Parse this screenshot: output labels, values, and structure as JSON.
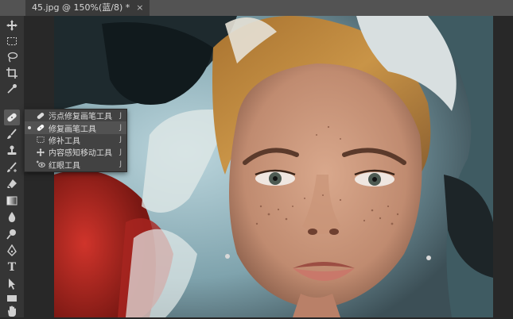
{
  "document": {
    "tab_title": "45.jpg @ 150%(蓝/8) *",
    "close_glyph": "×"
  },
  "tools": [
    {
      "name": "move-tool",
      "icon": "move-icon"
    },
    {
      "name": "marquee-tool",
      "icon": "rect-marquee-icon"
    },
    {
      "name": "lasso-tool",
      "icon": "lasso-icon"
    },
    {
      "name": "crop-tool",
      "icon": "crop-icon"
    },
    {
      "name": "eyedropper-tool",
      "icon": "eyedropper-icon"
    },
    {
      "name": "healing-brush-tool",
      "icon": "bandage-icon",
      "active": true
    },
    {
      "name": "brush-tool",
      "icon": "brush-icon"
    },
    {
      "name": "clone-stamp-tool",
      "icon": "stamp-icon"
    },
    {
      "name": "history-brush-tool",
      "icon": "history-brush-icon"
    },
    {
      "name": "eraser-tool",
      "icon": "eraser-icon"
    },
    {
      "name": "gradient-tool",
      "icon": "gradient-icon"
    },
    {
      "name": "blur-tool",
      "icon": "drop-icon"
    },
    {
      "name": "dodge-tool",
      "icon": "dodge-icon"
    },
    {
      "name": "pen-tool",
      "icon": "pen-icon"
    },
    {
      "name": "type-tool",
      "icon": "type-icon",
      "glyph": "T"
    },
    {
      "name": "path-selection-tool",
      "icon": "arrow-icon"
    },
    {
      "name": "rectangle-tool",
      "icon": "rectangle-icon"
    },
    {
      "name": "hand-tool",
      "icon": "hand-icon"
    }
  ],
  "flyout": {
    "items": [
      {
        "label": "污点修复画笔工具",
        "key": "J",
        "icon": "spot-healing-icon",
        "selected": false
      },
      {
        "label": "修复画笔工具",
        "key": "J",
        "icon": "healing-brush-icon",
        "selected": true
      },
      {
        "label": "修补工具",
        "key": "J",
        "icon": "patch-icon",
        "selected": false
      },
      {
        "label": "内容感知移动工具",
        "key": "J",
        "icon": "content-aware-move-icon",
        "selected": false
      },
      {
        "label": "红眼工具",
        "key": "J",
        "icon": "red-eye-icon",
        "selected": false
      }
    ]
  }
}
